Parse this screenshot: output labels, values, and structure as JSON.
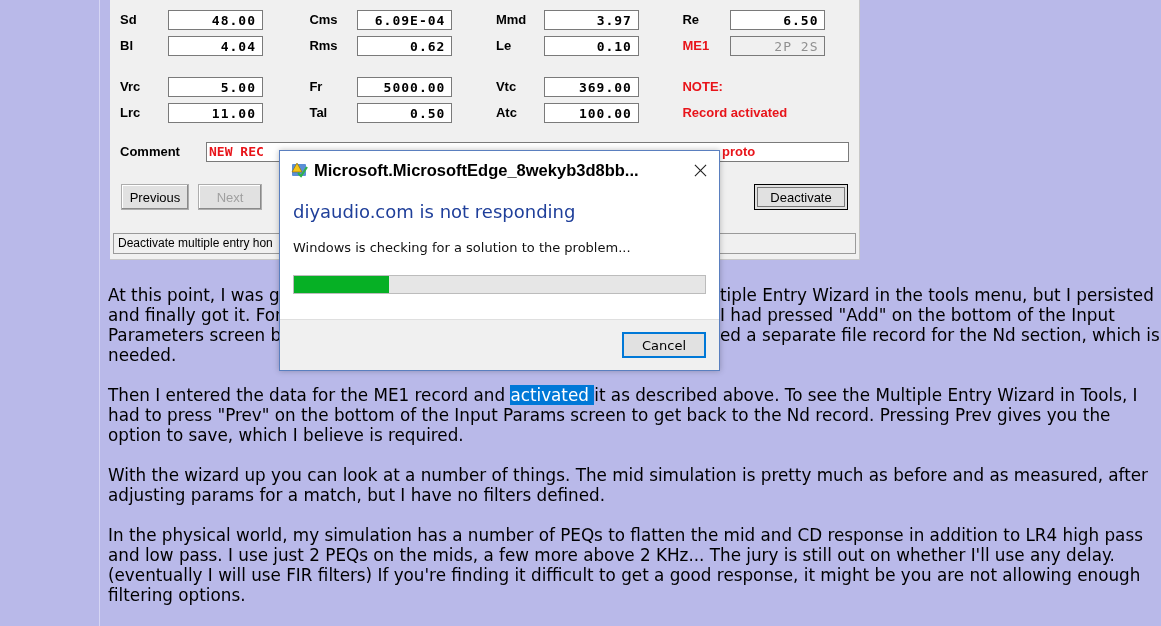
{
  "form": {
    "parameter_blocks": [
      [
        [
          {
            "label": "Sd",
            "color": "#000000",
            "value": "48.00",
            "disabled": false
          },
          {
            "label": "Cms",
            "color": "#000000",
            "value": "6.09E-04",
            "disabled": false
          },
          {
            "label": "Mmd",
            "color": "#000000",
            "value": "3.97",
            "disabled": false
          },
          {
            "label": "Re",
            "color": "#000000",
            "value": "6.50",
            "disabled": false
          }
        ],
        [
          {
            "label": "Bl",
            "color": "#000000",
            "value": "4.04",
            "disabled": false
          },
          {
            "label": "Rms",
            "color": "#000000",
            "value": "0.62",
            "disabled": false
          },
          {
            "label": "Le",
            "color": "#000000",
            "value": "0.10",
            "disabled": false
          },
          {
            "label": "ME1",
            "color": "#e8141a",
            "value": "2P 2S",
            "disabled": true
          }
        ]
      ],
      [
        [
          {
            "label": "Vrc",
            "color": "#000000",
            "value": "5.00",
            "disabled": false
          },
          {
            "label": "Fr",
            "color": "#000000",
            "value": "5000.00",
            "disabled": false
          },
          {
            "label": "Vtc",
            "color": "#000000",
            "value": "369.00",
            "disabled": false
          },
          {
            "label": "NOTE:",
            "color": "#e8141a"
          }
        ],
        [
          {
            "label": "Lrc",
            "color": "#000000",
            "value": "11.00",
            "disabled": false
          },
          {
            "label": "Tal",
            "color": "#000000",
            "value": "0.50",
            "disabled": false
          },
          {
            "label": "Atc",
            "color": "#000000",
            "value": "100.00",
            "disabled": false
          },
          {
            "label": "Record activated",
            "color": "#e8141a"
          }
        ]
      ]
    ],
    "comment": {
      "label": "Comment",
      "value_start": "NEW REC",
      "value_end": "proto"
    },
    "buttons": [
      {
        "label": "Previous",
        "disabled": false
      },
      {
        "label": "Next",
        "disabled": true
      }
    ],
    "deactivate_button": "Deactivate",
    "status_bar": "Deactivate multiple entry hon"
  },
  "paragraphs": [
    {
      "kind": "split",
      "left": [
        "At this point, I was g",
        "and finally got it. For",
        "Parameters screen b",
        "needed."
      ],
      "right": [
        "tiple Entry Wizard in the tools menu, but I persisted",
        "I had pressed \"Add\" on the bottom of the Input",
        "ed a separate file record for the Nd section, which is"
      ]
    },
    {
      "kind": "selection",
      "before": "Then I entered the data for the ME1 record and ",
      "selected_text": "activated ",
      "after": "it as described above. To see the Multiple Entry Wizard in Tools, I\nhad to press \"Prev\" on the bottom of the Input Params screen to get back to the Nd record. Pressing Prev gives you the\noption to save, which I believe is required."
    },
    {
      "kind": "plain",
      "text": "With the wizard up you can look at a number of things. The mid simulation is pretty much as before and as measured, after\nadjusting params for a match, but I have no filters defined."
    },
    {
      "kind": "plain",
      "text": "In the physical world, my simulation has a number of PEQs to flatten the mid and CD response in addition to LR4 high pass\nand low pass. I use just 2 PEQs on the mids, a few more above 2 KHz... The jury is still out on whether I'll use any delay.\n(eventually I will use FIR filters) If you're finding it difficult to get a good response, it might be you are not allowing enough\nfiltering options."
    }
  ],
  "dialog": {
    "title": "Microsoft.MicrosoftEdge_8wekyb3d8bb...",
    "heading": "diyaudio.com is not responding",
    "message": "Windows is checking for a solution to the problem...",
    "progress": {
      "level": 0.23
    },
    "cancel_button": "Cancel"
  }
}
